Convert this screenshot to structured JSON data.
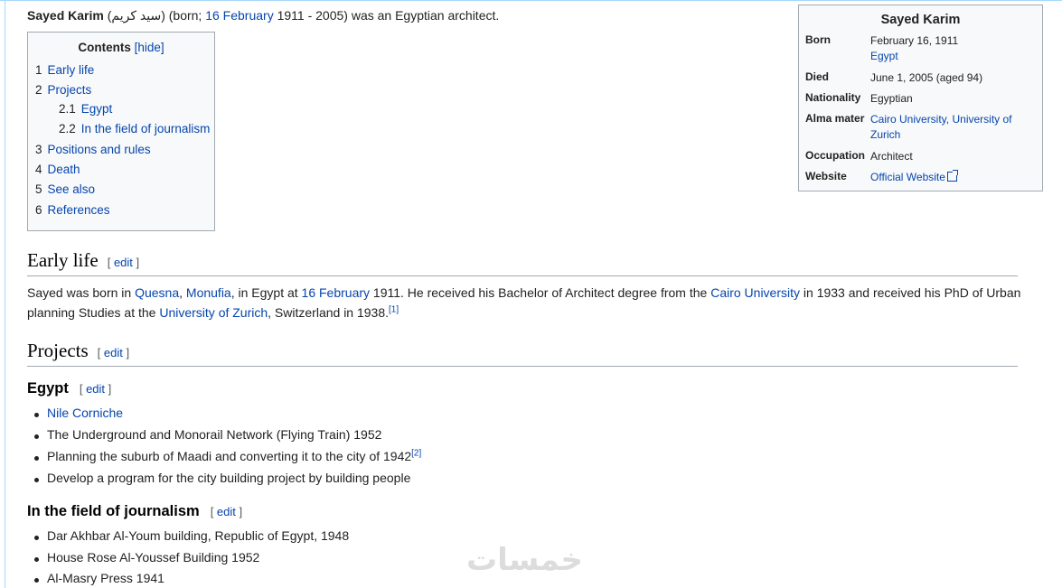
{
  "lead": {
    "name": "Sayed Karim",
    "arabic": "(سيد كريم)",
    "born_prefix": "(born;",
    "born_link": "16 February",
    "rest": "1911 - 2005) was an Egyptian architect."
  },
  "toc": {
    "title": "Contents",
    "hide_label": "[hide]",
    "items": [
      {
        "num": "1",
        "label": "Early life"
      },
      {
        "num": "2",
        "label": "Projects"
      },
      {
        "num": "2.1",
        "label": "Egypt"
      },
      {
        "num": "2.2",
        "label": "In the field of journalism"
      },
      {
        "num": "3",
        "label": "Positions and rules"
      },
      {
        "num": "4",
        "label": "Death"
      },
      {
        "num": "5",
        "label": "See also"
      },
      {
        "num": "6",
        "label": "References"
      }
    ]
  },
  "infobox": {
    "title": "Sayed Karim",
    "born_label": "Born",
    "born_date": "February 16, 1911",
    "born_place": "Egypt",
    "died_label": "Died",
    "died_value": "June 1, 2005 (aged 94)",
    "nationality_label": "Nationality",
    "nationality_value": "Egyptian",
    "alma_label": "Alma mater",
    "alma_1": "Cairo University,",
    "alma_2": "University of Zurich",
    "occupation_label": "Occupation",
    "occupation_value": "Architect",
    "website_label": "Website",
    "website_value": "Official Website"
  },
  "edit_label": "edit",
  "early_life": {
    "heading": "Early life",
    "t1": "Sayed was born in ",
    "l_quesna": "Quesna",
    "comma1": ", ",
    "l_monufia": "Monufia",
    "t2": ", in Egypt at ",
    "l_date": "16 February",
    "t3": " 1911. He received his Bachelor of Architect degree from the ",
    "l_cairo": "Cairo University",
    "t4": " in 1933 and received his PhD of Urban planning Studies at the ",
    "l_zurich": "University of Zurich",
    "t5": ", Switzerland in 1938.",
    "ref": "[1]"
  },
  "projects": {
    "heading": "Projects",
    "egypt_heading": "Egypt",
    "egypt_items": [
      "Nile Corniche",
      "The Underground and Monorail Network (Flying Train) 1952",
      "Planning the suburb of Maadi and converting it to the city of 1942",
      "Develop a program for the city building project by building people"
    ],
    "egypt_ref": "[2]",
    "journalism_heading": "In the field of journalism",
    "journalism_items": [
      "Dar Akhbar Al-Youm building, Republic of Egypt, 1948",
      "House Rose Al-Youssef Building 1952",
      "Al-Masry Press 1941"
    ]
  },
  "watermark": "خمسات"
}
